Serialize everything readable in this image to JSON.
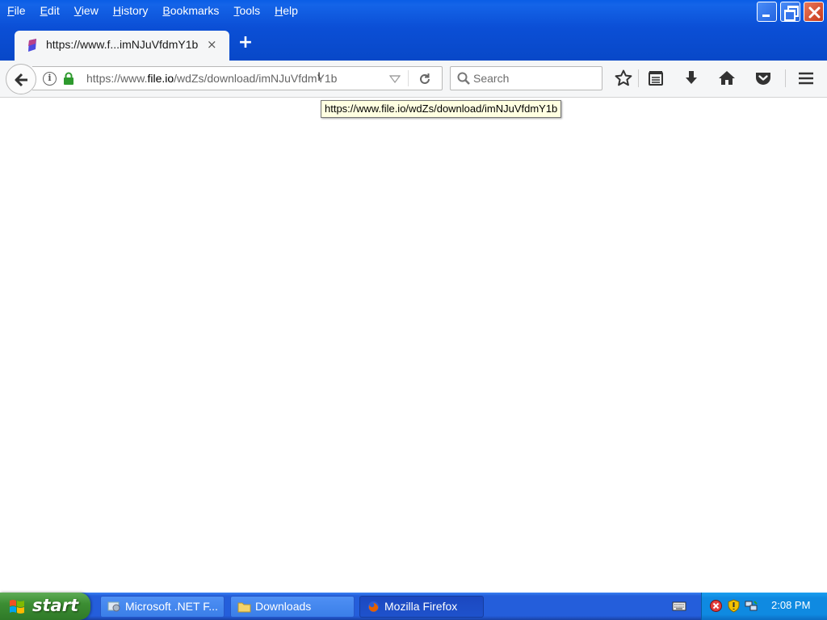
{
  "menu": {
    "items": [
      "File",
      "Edit",
      "View",
      "History",
      "Bookmarks",
      "Tools",
      "Help"
    ]
  },
  "window_controls": {
    "minimize": "minimize",
    "maximize": "restore",
    "close": "close"
  },
  "tab": {
    "title": "https://www.f...imNJuVfdmY1b",
    "close_glyph": "×",
    "new_tab_glyph": "+"
  },
  "urlbar": {
    "prefix": "https://www.",
    "host": "file.io",
    "path": "/wdZs/download/imNJuVfdmY1b"
  },
  "search": {
    "placeholder": "Search"
  },
  "tooltip": {
    "text": "https://www.file.io/wdZs/download/imNJuVfdmY1b"
  },
  "toolbar_icons": [
    "bookmark-star-icon",
    "reading-list-icon",
    "download-icon",
    "home-icon",
    "pocket-icon",
    "hamburger-menu-icon"
  ],
  "taskbar": {
    "start_label": "start",
    "tasks": [
      {
        "label": "Microsoft .NET F...",
        "icon": "installer-icon"
      },
      {
        "label": "Downloads",
        "icon": "folder-icon"
      },
      {
        "label": "Mozilla Firefox",
        "icon": "firefox-icon",
        "active": true
      }
    ],
    "clock": "2:08 PM"
  },
  "colors": {
    "titlebar_blue": "#0b4fd6",
    "taskbar_blue": "#245edb",
    "start_green": "#3c8e33",
    "tray_blue": "#0f8ae1",
    "tooltip_bg": "#ffffe1",
    "lock_green": "#2e9a2e"
  }
}
